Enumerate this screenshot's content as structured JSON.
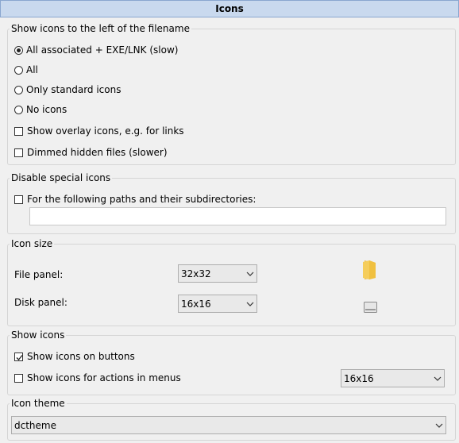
{
  "header": {
    "title": "Icons"
  },
  "show_icons_left": {
    "legend": "Show icons to the left of the filename",
    "radios": [
      {
        "label": "All associated + EXE/LNK (slow)",
        "checked": true
      },
      {
        "label": "All",
        "checked": false
      },
      {
        "label": "Only standard icons",
        "checked": false
      },
      {
        "label": "No icons",
        "checked": false
      }
    ],
    "checks": [
      {
        "label": "Show overlay icons, e.g. for links",
        "checked": false
      },
      {
        "label": "Dimmed hidden files (slower)",
        "checked": false
      }
    ]
  },
  "disable_special": {
    "legend": "Disable special icons",
    "check": {
      "label": "For the following paths and their subdirectories:",
      "checked": false
    },
    "paths_value": ""
  },
  "icon_size": {
    "legend": "Icon size",
    "file_panel_label": "File panel:",
    "file_panel_value": "32x32",
    "disk_panel_label": "Disk panel:",
    "disk_panel_value": "16x16",
    "file_preview_icon": "folder-icon",
    "disk_preview_icon": "drive-icon"
  },
  "show_icons": {
    "legend": "Show icons",
    "buttons_check": {
      "label": "Show icons on buttons",
      "checked": true
    },
    "menus_check": {
      "label": "Show icons for actions in menus",
      "checked": false
    },
    "menus_size_value": "16x16"
  },
  "icon_theme": {
    "legend": "Icon theme",
    "value": "dctheme"
  }
}
